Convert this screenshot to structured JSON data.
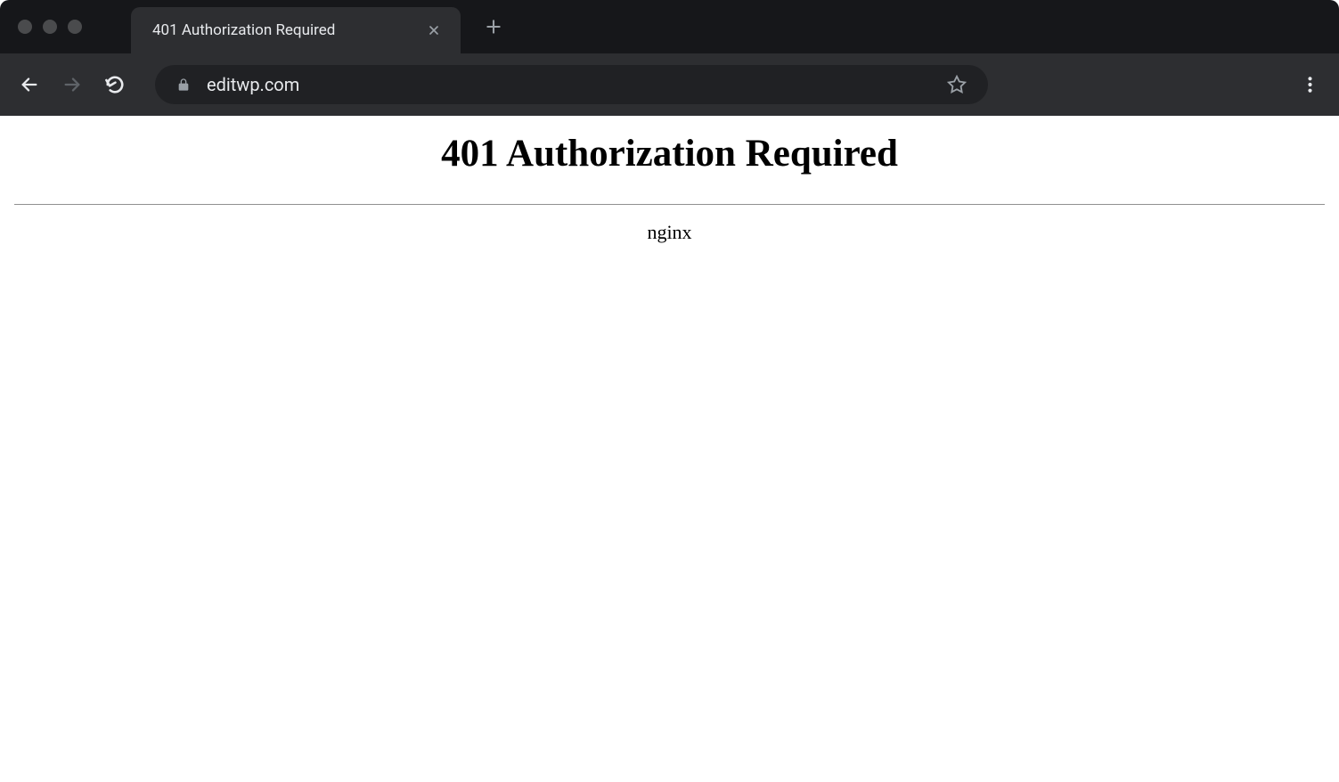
{
  "tab": {
    "title": "401 Authorization Required"
  },
  "address_bar": {
    "url": "editwp.com"
  },
  "page": {
    "heading": "401 Authorization Required",
    "server": "nginx"
  }
}
